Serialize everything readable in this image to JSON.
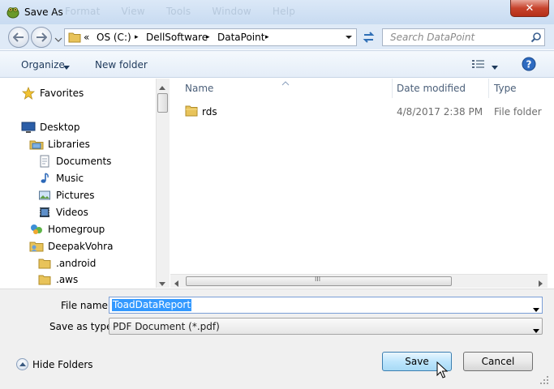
{
  "window": {
    "title": "Save As",
    "close_label": "✕",
    "background_menu": [
      "Format",
      "View",
      "Tools",
      "Window",
      "Help"
    ]
  },
  "address": {
    "chevron": "«",
    "crumbs": [
      "OS (C:)",
      "DellSoftware",
      "DataPoint"
    ],
    "separator": "▸"
  },
  "search": {
    "placeholder": "Search DataPoint"
  },
  "toolbar": {
    "organize_label": "Organize",
    "new_folder_label": "New folder"
  },
  "nav": {
    "items": [
      {
        "label": "Favorites",
        "icon": "star-icon"
      },
      {
        "label": "Desktop",
        "icon": "desktop-icon"
      },
      {
        "label": "Libraries",
        "icon": "libraries-icon"
      },
      {
        "label": "Documents",
        "icon": "documents-icon"
      },
      {
        "label": "Music",
        "icon": "music-icon"
      },
      {
        "label": "Pictures",
        "icon": "pictures-icon"
      },
      {
        "label": "Videos",
        "icon": "videos-icon"
      },
      {
        "label": "Homegroup",
        "icon": "homegroup-icon"
      },
      {
        "label": "DeepakVohra",
        "icon": "user-folder-icon"
      },
      {
        "label": ".android",
        "icon": "folder-icon"
      },
      {
        "label": ".aws",
        "icon": "folder-icon"
      }
    ]
  },
  "filelist": {
    "columns": {
      "name": "Name",
      "date": "Date modified",
      "type": "Type"
    },
    "rows": [
      {
        "name": "rds",
        "date": "4/8/2017 2:38 PM",
        "type": "File folder"
      }
    ],
    "scroll_grip": "III"
  },
  "form": {
    "filename_label": "File name:",
    "filename_value": "ToadDataReport",
    "savetype_label": "Save as type:",
    "savetype_value": "PDF Document (*.pdf)"
  },
  "footer": {
    "hide_folders_label": "Hide Folders",
    "save_label": "Save",
    "cancel_label": "Cancel"
  },
  "colors": {
    "accent": "#3399ff",
    "close": "#c7432c",
    "folder": "#e8c35a",
    "link": "#1e395b"
  }
}
